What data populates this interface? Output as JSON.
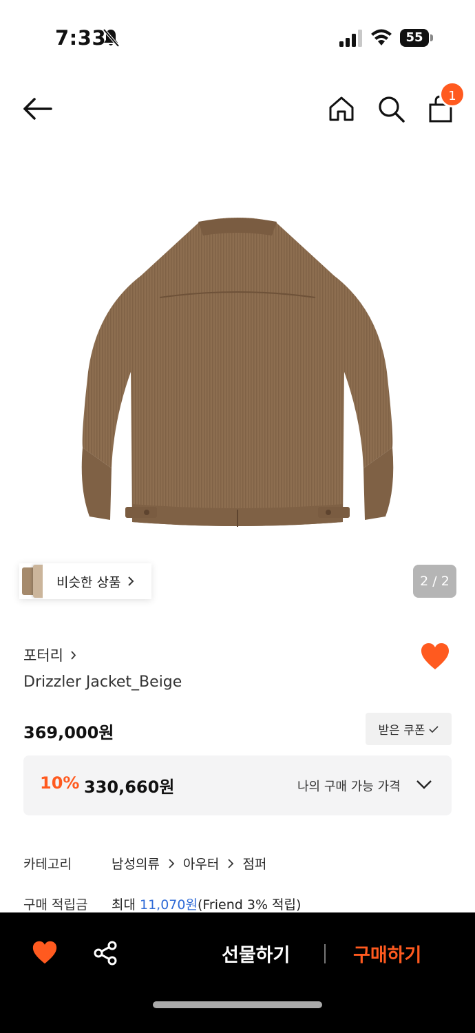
{
  "status_bar": {
    "time": "7:33",
    "battery": "55"
  },
  "nav": {
    "cart_badge": "1"
  },
  "gallery": {
    "similar_label": "비슷한 상품",
    "page_indicator": "2 / 2"
  },
  "product": {
    "brand": "포터리",
    "name": "Drizzler Jacket_Beige",
    "price": "369,000원",
    "coupon_label": "받은 쿠폰",
    "discount_rate": "10%",
    "discount_price": "330,660원",
    "my_price_label": "나의 구매 가능 가격",
    "liked": true
  },
  "details": {
    "category_label": "카테고리",
    "category_path": [
      "남성의류",
      "아우터",
      "점퍼"
    ],
    "points_label": "구매 적립금",
    "points_prefix": "최대 ",
    "points_amount": "11,070원",
    "points_suffix": "(Friend 3% 적립)"
  },
  "bottom_bar": {
    "gift_label": "선물하기",
    "buy_label": "구매하기"
  },
  "colors": {
    "accent": "#ff5a1f",
    "link_blue": "#2f6bd7",
    "jacket": "#8a6b4c"
  }
}
